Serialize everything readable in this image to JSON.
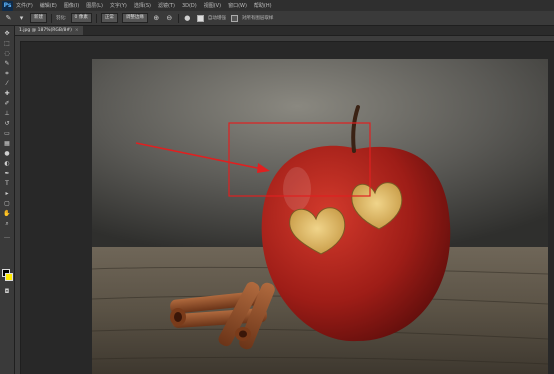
{
  "app": {
    "logo": "Ps"
  },
  "menu": [
    "文件(F)",
    "编辑(E)",
    "图像(I)",
    "图层(L)",
    "文字(Y)",
    "选择(S)",
    "滤镜(T)",
    "3D(D)",
    "视图(V)",
    "窗口(W)",
    "帮助(H)"
  ],
  "options": {
    "mode_value": "新建",
    "feather_label": "羽化:",
    "feather_value": "0 像素",
    "style_value": "正常",
    "refine_label": "调整边缘",
    "auto_enhance_label": "自动增强",
    "sample_all_label": "对所有图层取样"
  },
  "document": {
    "tab_title": "1.jpg @ 187%(RGB/8#)",
    "close": "×"
  },
  "colors": {
    "foreground": "#000000",
    "background": "#ffea00",
    "annotation": "#e02020"
  },
  "icons": {
    "quick-select": "brush-icon",
    "move": "move-icon",
    "marquee": "marquee-icon",
    "lasso": "lasso-icon",
    "crop": "crop-icon",
    "eyedropper": "eyedropper-icon",
    "brush": "brush-icon",
    "stamp": "stamp-icon",
    "eraser": "eraser-icon",
    "gradient": "gradient-icon",
    "dodge": "dodge-icon",
    "pen": "pen-icon",
    "type": "type-icon",
    "path-select": "path-select-icon",
    "shape": "shape-icon",
    "hand": "hand-icon",
    "zoom": "zoom-icon"
  }
}
